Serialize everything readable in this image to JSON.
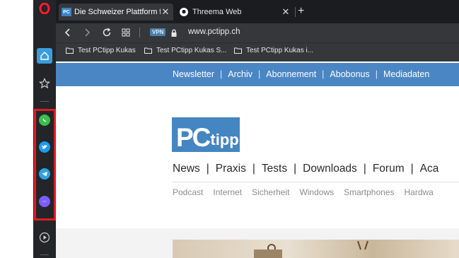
{
  "tabs": [
    {
      "title": "Die Schweizer Plattform für",
      "favicon": "PC",
      "active": true
    },
    {
      "title": "Threema Web",
      "active": false
    }
  ],
  "address_bar": {
    "vpn_label": "VPN",
    "url": "www.pctipp.ch"
  },
  "bookmarks": [
    "Test PCtipp Kukas",
    "Test PCtipp Kukas S...",
    "Test PCtipp Kukas i..."
  ],
  "sidebar": {
    "messengers": [
      "whatsapp",
      "twitter",
      "telegram",
      "messenger"
    ],
    "colors": {
      "whatsapp": "#3dbb4f",
      "twitter": "#1d9bf0",
      "telegram": "#2aa3e0",
      "messenger": "#7a5cff",
      "highlight": "#e01b24"
    }
  },
  "site": {
    "top_nav": [
      "Newsletter",
      "Archiv",
      "Abonnement",
      "Abobonus",
      "Mediadaten"
    ],
    "logo": {
      "pc": "PC",
      "tipp": "tipp"
    },
    "main_nav": [
      "News",
      "Praxis",
      "Tests",
      "Downloads",
      "Forum",
      "Aca"
    ],
    "sub_nav": [
      "Podcast",
      "Internet",
      "Sicherheit",
      "Windows",
      "Smartphones",
      "Hardwa"
    ]
  }
}
